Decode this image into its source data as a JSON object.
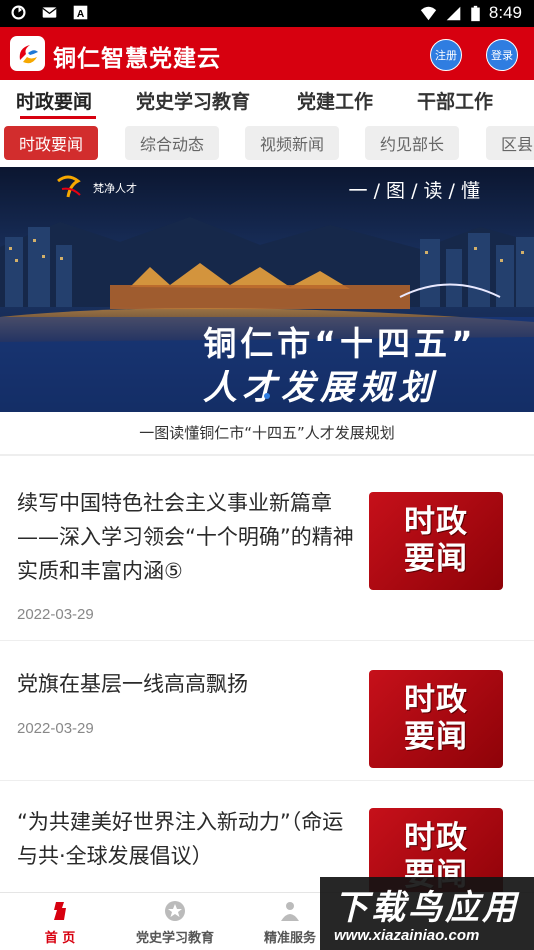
{
  "status_bar": {
    "time": "8:49"
  },
  "app": {
    "title": "铜仁智慧党建云",
    "register_label": "注册",
    "login_label": "登录"
  },
  "primary_tabs": [
    "时政要闻",
    "党史学习教育",
    "党建工作",
    "干部工作"
  ],
  "sub_tabs": [
    "时政要闻",
    "综合动态",
    "视频新闻",
    "约见部长",
    "区县"
  ],
  "banner": {
    "tag": "一 / 图 / 读 / 懂",
    "brand": "梵净人才",
    "headline_1": "铜仁市“十四五”",
    "headline_2": "人才发展规划",
    "caption": "一图读懂铜仁市“十四五”人才发展规划"
  },
  "news": [
    {
      "title": "续写中国特色社会主义事业新篇章——深入学习领会“十个明确”的精神实质和丰富内涵⑤",
      "date": "2022-03-29",
      "thumb_line1": "时政",
      "thumb_line2": "要闻"
    },
    {
      "title": "党旗在基层一线高高飘扬",
      "date": "2022-03-29",
      "thumb_line1": "时政",
      "thumb_line2": "要闻"
    },
    {
      "title": "“为共建美好世界注入新动力”（命运与共·全球发展倡议）",
      "date": "",
      "thumb_line1": "时政",
      "thumb_line2": "要闻"
    }
  ],
  "bottom_nav": [
    {
      "label": "首 页",
      "icon": "home-icon"
    },
    {
      "label": "党史学习教育",
      "icon": "star-icon"
    },
    {
      "label": "精准服务",
      "icon": "service-icon"
    }
  ],
  "watermark": {
    "text": "下载鸟应用",
    "url": "www.xiazainiao.com"
  },
  "colors": {
    "brand_red": "#d7000f",
    "chip_active": "#d22d2d",
    "login_blue": "#2f7de1"
  }
}
